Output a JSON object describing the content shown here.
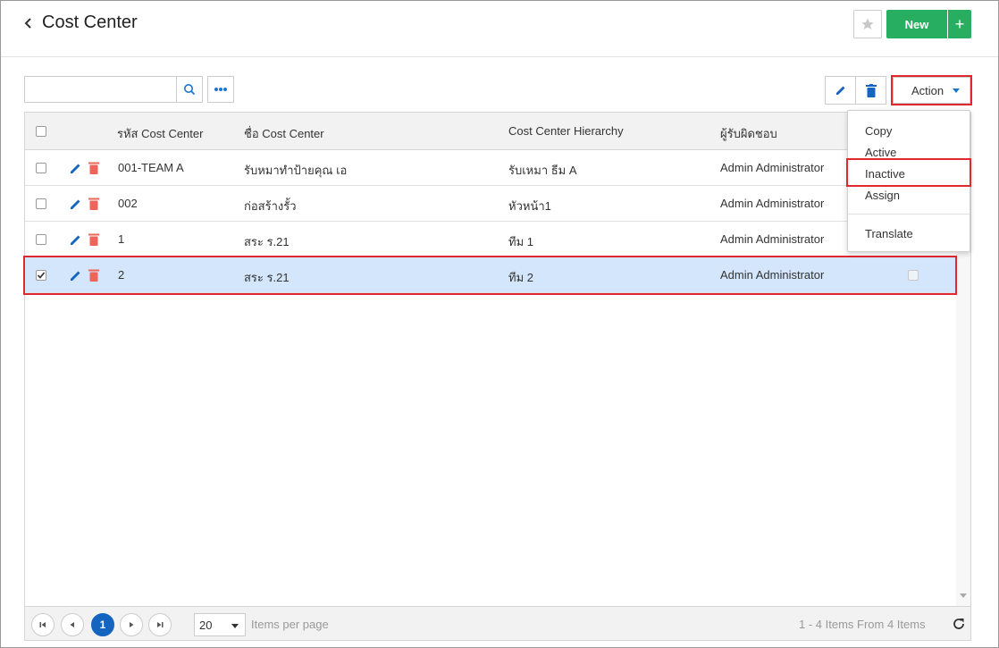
{
  "header": {
    "title": "Cost Center",
    "new_label": "New",
    "new_plus": "+"
  },
  "toolbar": {
    "search_placeholder": "",
    "action_label": "Action"
  },
  "table": {
    "columns": [
      "รหัส Cost Center",
      "ชื่อ Cost Center",
      "Cost Center Hierarchy",
      "ผู้รับผิดชอบ"
    ],
    "rows": [
      {
        "code": "001-TEAM A",
        "name": "รับหมาทำป้ายคุณ เอ",
        "hierarchy": "รับเหมา ธีม A",
        "owner": "Admin Administrator",
        "checked": false
      },
      {
        "code": "002",
        "name": "ก่อสร้างรั้ว",
        "hierarchy": "หัวหน้า1",
        "owner": "Admin Administrator",
        "checked": false
      },
      {
        "code": "1",
        "name": "สระ ร.21",
        "hierarchy": "ทีม 1",
        "owner": "Admin Administrator",
        "checked": false
      },
      {
        "code": "2",
        "name": "สระ ร.21",
        "hierarchy": "ทีม 2",
        "owner": "Admin Administrator",
        "checked": true
      }
    ]
  },
  "action_menu": {
    "items": [
      "Copy",
      "Active",
      "Inactive",
      "Assign",
      "Translate"
    ]
  },
  "pager": {
    "current_page": "1",
    "page_size": "20",
    "per_page_label": "Items per page",
    "info": "1 - 4 Items From 4 Items"
  },
  "colors": {
    "accent": "#1976d2",
    "new_button": "#27ae60",
    "delete": "#f0635a",
    "highlight": "#e0282e",
    "selected_row": "#d4e6fb"
  }
}
